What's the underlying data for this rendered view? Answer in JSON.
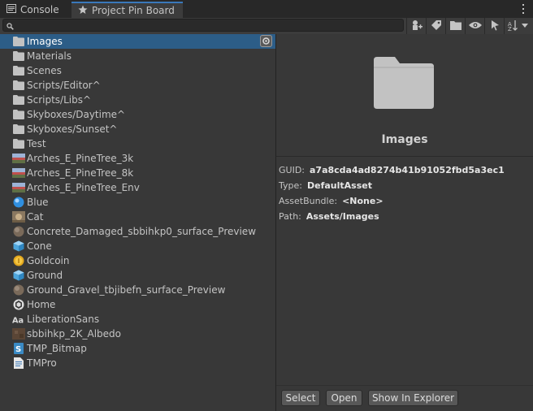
{
  "tabs": [
    {
      "label": "Console",
      "icon": "console-icon"
    },
    {
      "label": "Project Pin Board",
      "icon": "star-icon"
    }
  ],
  "search": {
    "placeholder": ""
  },
  "toolbar_buttons": [
    "create-icon",
    "label-icon",
    "folder-filter-icon",
    "eye-icon",
    "select-arrow-icon",
    "sort-icon"
  ],
  "items": [
    {
      "label": "Images",
      "icon": "folder-icon",
      "selected": true
    },
    {
      "label": "Materials",
      "icon": "folder-icon"
    },
    {
      "label": "Scenes",
      "icon": "folder-icon"
    },
    {
      "label": "Scripts/Editor^",
      "icon": "folder-icon"
    },
    {
      "label": "Scripts/Libs^",
      "icon": "folder-icon"
    },
    {
      "label": "Skyboxes/Daytime^",
      "icon": "folder-icon"
    },
    {
      "label": "Skyboxes/Sunset^",
      "icon": "folder-icon"
    },
    {
      "label": "Test",
      "icon": "folder-icon"
    },
    {
      "label": "Arches_E_PineTree_3k",
      "icon": "texture-icon"
    },
    {
      "label": "Arches_E_PineTree_8k",
      "icon": "texture-icon"
    },
    {
      "label": "Arches_E_PineTree_Env",
      "icon": "texture-icon"
    },
    {
      "label": "Blue",
      "icon": "material-icon"
    },
    {
      "label": "Cat",
      "icon": "image-icon"
    },
    {
      "label": "Concrete_Damaged_sbbihkp0_surface_Preview",
      "icon": "sphere-icon"
    },
    {
      "label": "Cone",
      "icon": "prefab-icon"
    },
    {
      "label": "Goldcoin",
      "icon": "coin-icon"
    },
    {
      "label": "Ground",
      "icon": "prefab-icon"
    },
    {
      "label": "Ground_Gravel_tbjibefn_surface_Preview",
      "icon": "sphere-icon"
    },
    {
      "label": "Home",
      "icon": "unity-scene-icon"
    },
    {
      "label": "LiberationSans",
      "icon": "font-icon"
    },
    {
      "label": "sbbihkp_2K_Albedo",
      "icon": "texture-icon"
    },
    {
      "label": "TMP_Bitmap",
      "icon": "shader-icon"
    },
    {
      "label": "TMPro",
      "icon": "text-file-icon"
    }
  ],
  "detail": {
    "title": "Images",
    "guid_label": "GUID:",
    "guid": "a7a8cda4ad8274b41b91052fbd5a3ec1",
    "type_label": "Type:",
    "type": "DefaultAsset",
    "bundle_label": "AssetBundle:",
    "bundle": "<None>",
    "path_label": "Path:",
    "path": "Assets/Images"
  },
  "buttons": {
    "select": "Select",
    "open": "Open",
    "explorer": "Show In Explorer"
  },
  "colors": {
    "selection": "#2c5d87",
    "accent": "#3a79bb",
    "folder": "#c2c2c2"
  }
}
